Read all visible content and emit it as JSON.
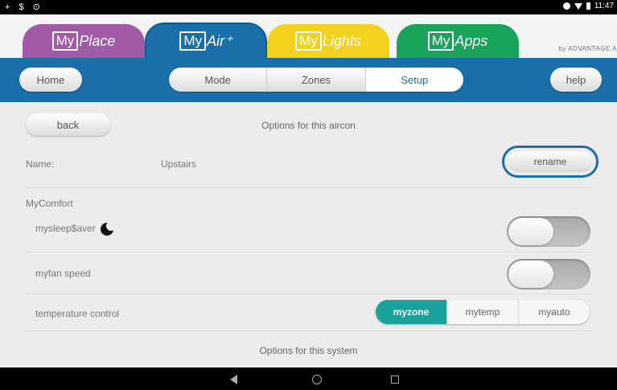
{
  "status_bar": {
    "left_icons": "+ $ ⊙",
    "time": "11:47"
  },
  "app_tabs": [
    {
      "boxed": "My",
      "rest": "Place"
    },
    {
      "boxed": "My",
      "rest": "Air⁺"
    },
    {
      "boxed": "My",
      "rest": "Lights"
    },
    {
      "boxed": "My",
      "rest": "Apps"
    }
  ],
  "brand": "by ADVANTAGE A",
  "nav": {
    "home": "Home",
    "tabs": [
      "Mode",
      "Zones",
      "Setup"
    ],
    "active_tab": "Setup",
    "help": "help"
  },
  "main": {
    "back": "back",
    "options_aircon": "Options for this aircon",
    "name_label": "Name:",
    "name_value": "Upstairs",
    "rename": "rename",
    "mycomfort": "MyComfort",
    "mysleepsaver": "mysleep$aver",
    "myfan_speed": "myfan speed",
    "mysleepsaver_on": false,
    "myfan_speed_on": false,
    "temperature_control": "temperature control",
    "temp_options": [
      "myzone",
      "mytemp",
      "myauto"
    ],
    "temp_selected": "myzone",
    "options_system": "Options for this system"
  },
  "colors": {
    "primary": "#1a6fa8",
    "accent": "#1aa39a",
    "place": "#a05aa6",
    "lights": "#f3d11f",
    "apps": "#1aa35a"
  }
}
